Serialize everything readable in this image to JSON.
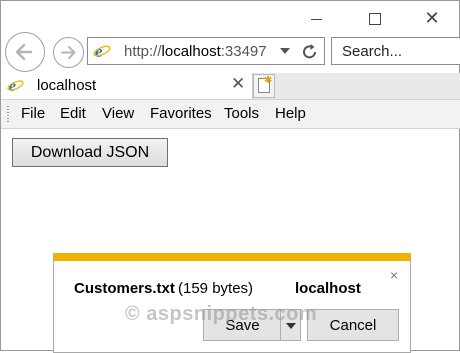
{
  "titlebar": {
    "close_glyph": "✕"
  },
  "address_bar": {
    "url_prefix": "http://",
    "url_host": "localhost",
    "url_port": ":33497"
  },
  "search": {
    "placeholder": "Search..."
  },
  "tab": {
    "title": "localhost",
    "close_glyph": "✕"
  },
  "menu": {
    "items": [
      "File",
      "Edit",
      "View",
      "Favorites",
      "Tools",
      "Help"
    ]
  },
  "page": {
    "download_button": "Download JSON"
  },
  "notification": {
    "filename": "Customers.txt",
    "size": "(159 bytes)",
    "host": "localhost",
    "save_label": "Save",
    "cancel_label": "Cancel",
    "close_glyph": "×"
  },
  "watermark": "© aspsnippets.com",
  "colors": {
    "accent": "#f0b400",
    "ie_blue": "#1a73c8"
  }
}
